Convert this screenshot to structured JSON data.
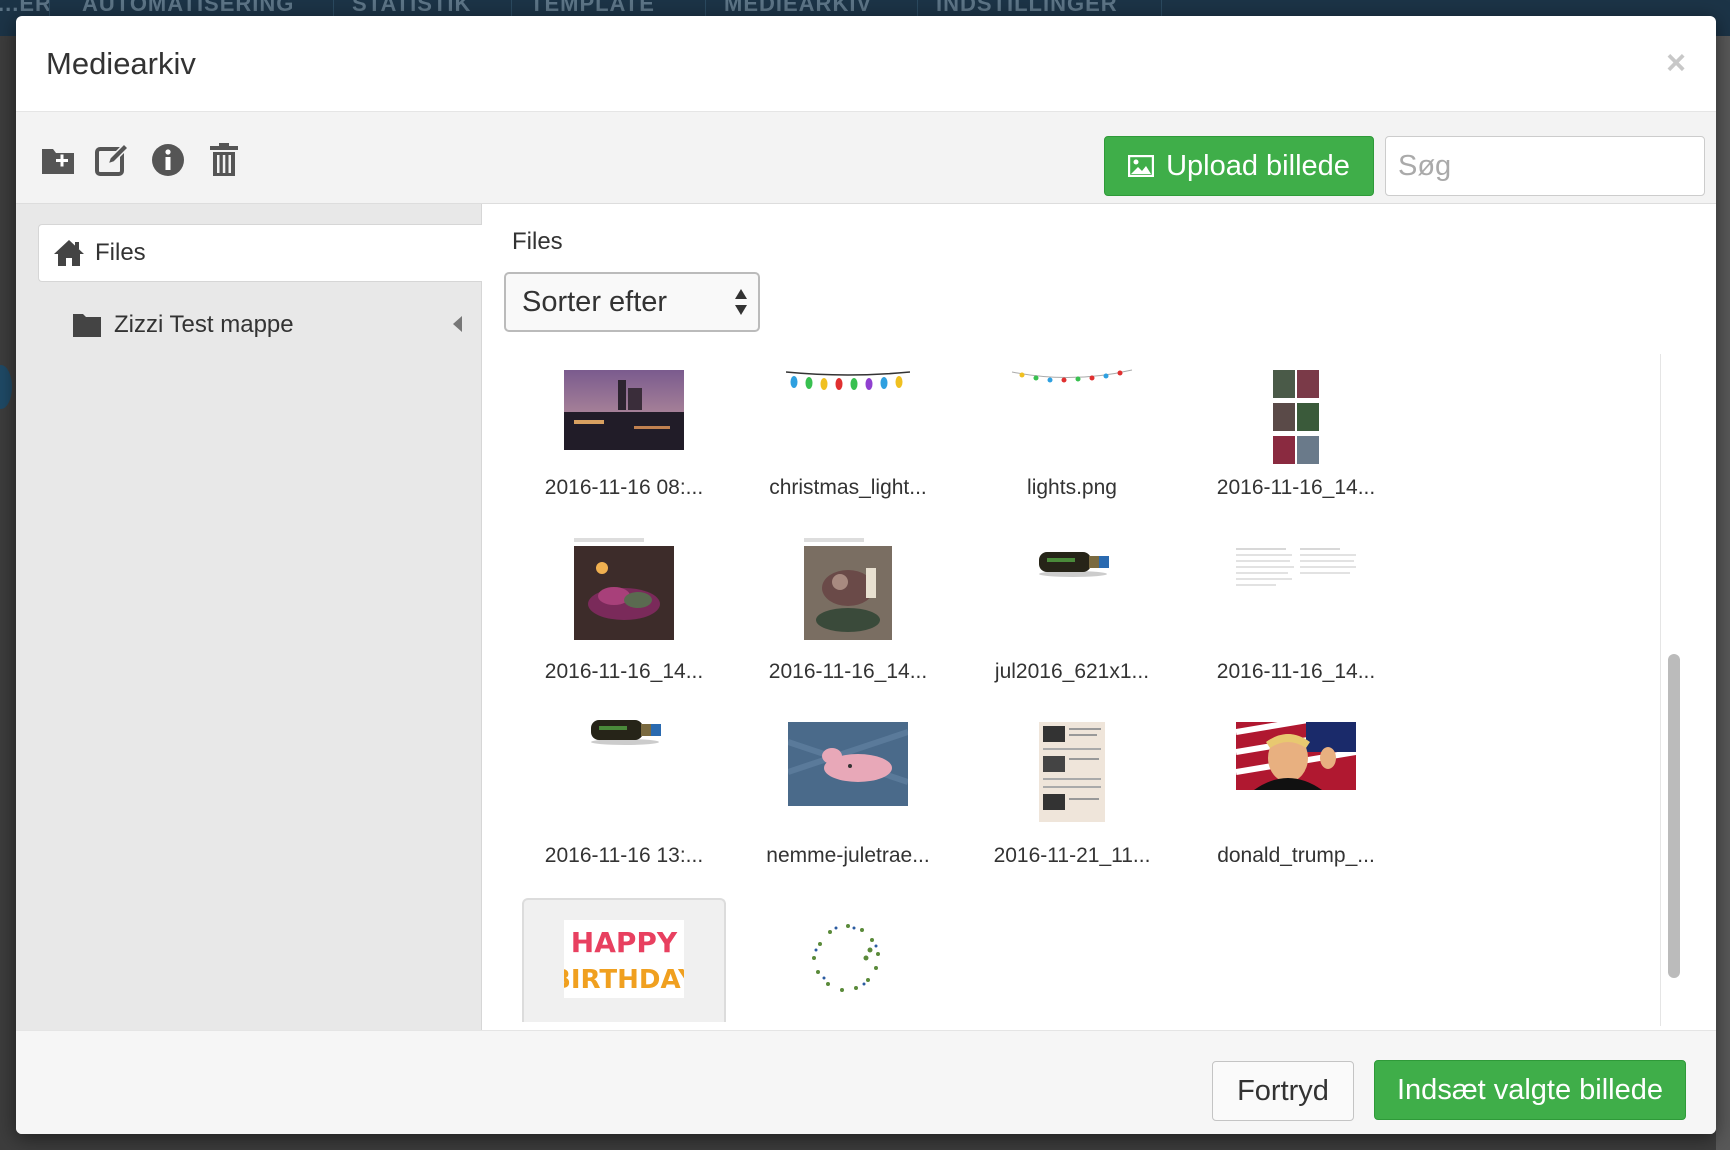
{
  "background": {
    "nav_tabs": [
      "...ER",
      "AUTOMATISERING",
      "STATISTIK",
      "TEMPLATE",
      "MEDIEARKIV",
      "INDSTILLINGER"
    ]
  },
  "modal": {
    "title": "Mediearkiv",
    "close_label": "×"
  },
  "toolbar": {
    "icons": [
      "new-folder-icon",
      "edit-icon",
      "info-icon",
      "trash-icon"
    ],
    "upload_label": "Upload billede",
    "search_placeholder": "Søg"
  },
  "sidebar": {
    "root_label": "Files",
    "folders": [
      {
        "label": "Zizzi Test mappe"
      }
    ]
  },
  "main": {
    "heading": "Files",
    "sort_label": "Sorter efter",
    "files": [
      {
        "name": "2016-11-16 08:..."
      },
      {
        "name": "christmas_light..."
      },
      {
        "name": "lights.png"
      },
      {
        "name": "2016-11-16_14..."
      },
      {
        "name": "2016-11-16_14..."
      },
      {
        "name": "2016-11-16_14..."
      },
      {
        "name": "jul2016_621x1..."
      },
      {
        "name": "2016-11-16_14..."
      },
      {
        "name": "2016-11-16 13:..."
      },
      {
        "name": "nemme-juletrae..."
      },
      {
        "name": "2016-11-21_11..."
      },
      {
        "name": "donald_trump_..."
      },
      {
        "name": "",
        "thumb_text": "HAPPY BIRTHDAY",
        "selected": true
      },
      {
        "name": ""
      }
    ]
  },
  "footer": {
    "cancel_label": "Fortryd",
    "insert_label": "Indsæt valgte billede"
  },
  "colors": {
    "primary_green": "#3fae49",
    "nav_bg": "#1c3447",
    "sidebar_bg": "#e8e8e8"
  }
}
